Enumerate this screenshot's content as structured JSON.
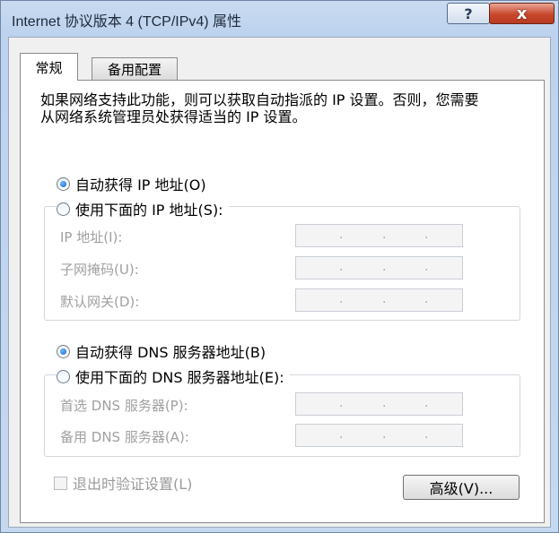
{
  "window": {
    "title": "Internet 协议版本 4 (TCP/IPv4) 属性",
    "help_icon": "?",
    "close_icon": "x"
  },
  "tabs": [
    {
      "label": "常规",
      "selected": true
    },
    {
      "label": "备用配置",
      "selected": false
    }
  ],
  "description": "如果网络支持此功能，则可以获取自动指派的 IP 设置。否则，您需要从网络系统管理员处获得适当的 IP 设置。",
  "ip": {
    "auto_label": "自动获得 IP 地址(O)",
    "auto_selected": true,
    "manual_label": "使用下面的 IP 地址(S):",
    "manual_selected": false,
    "fields": [
      {
        "label": "IP 地址(I):",
        "value": ". . ."
      },
      {
        "label": "子网掩码(U):",
        "value": ". . ."
      },
      {
        "label": "默认网关(D):",
        "value": ". . ."
      }
    ]
  },
  "dns": {
    "auto_label": "自动获得 DNS 服务器地址(B)",
    "auto_selected": true,
    "manual_label": "使用下面的 DNS 服务器地址(E):",
    "manual_selected": false,
    "fields": [
      {
        "label": "首选 DNS 服务器(P):",
        "value": ". . ."
      },
      {
        "label": "备用 DNS 服务器(A):",
        "value": ". . ."
      }
    ]
  },
  "validate_label": "退出时验证设置(L)",
  "validate_checked": false,
  "advanced_button": "高级(V)..."
}
